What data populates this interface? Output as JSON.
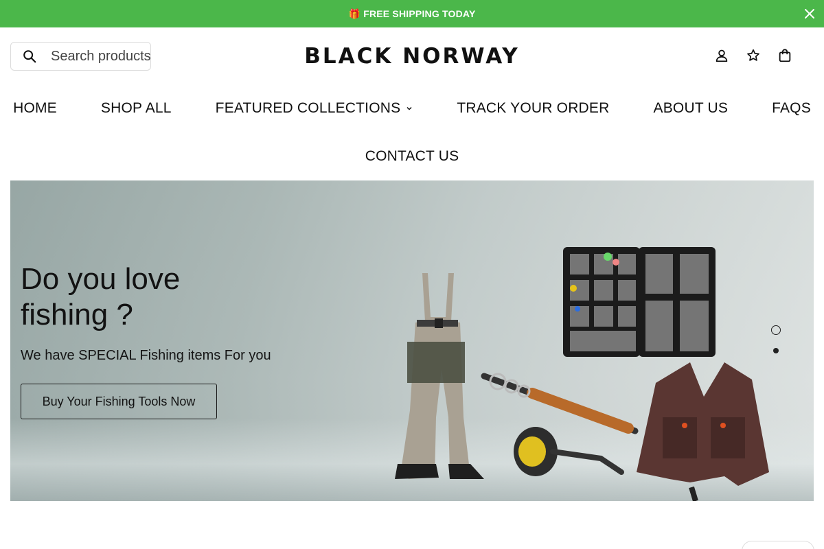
{
  "announcement": {
    "gift_emoji": "🎁",
    "text": "🎁 FREE SHIPPING TODAY",
    "bg_color": "#4bb74a",
    "close_icon": "close-icon"
  },
  "search": {
    "placeholder": "Search products",
    "icon": "search-icon"
  },
  "brand": {
    "logo_text": "BLACK NORWAY"
  },
  "header_icons": [
    "account-icon",
    "wishlist-star-icon",
    "cart-bag-icon"
  ],
  "nav": {
    "items": [
      {
        "label": "HOME"
      },
      {
        "label": "SHOP ALL"
      },
      {
        "label": "FEATURED COLLECTIONS",
        "has_dropdown": true
      },
      {
        "label": "TRACK YOUR ORDER"
      },
      {
        "label": "ABOUT US"
      },
      {
        "label": "FAQS"
      },
      {
        "label": "CONTACT US"
      }
    ]
  },
  "hero": {
    "title": "Do you love fishing ?",
    "subtitle": "We have SPECIAL Fishing items For you",
    "cta_label": "Buy Your Fishing Tools Now",
    "slides_total": 2,
    "active_slide": 1
  }
}
